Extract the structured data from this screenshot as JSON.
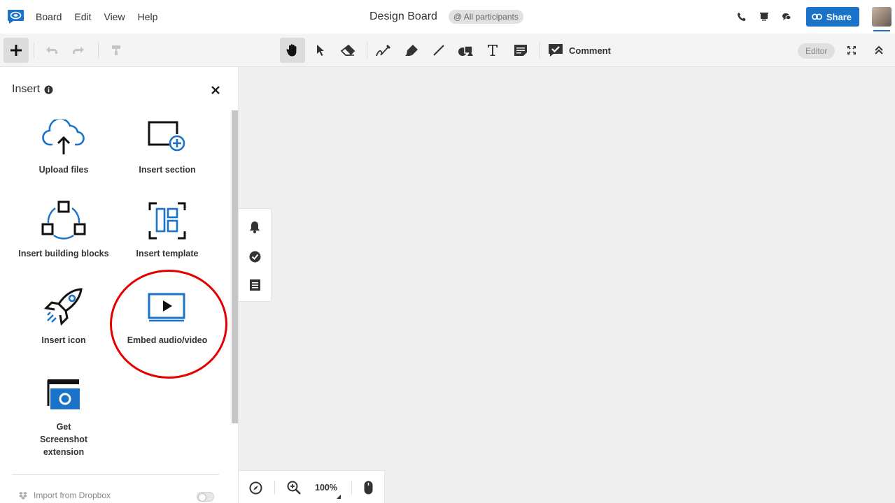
{
  "menu": [
    "Board",
    "Edit",
    "View",
    "Help"
  ],
  "document": {
    "title": "Design Board",
    "participants": "@ All participants"
  },
  "share": {
    "label": "Share"
  },
  "toolbar": {
    "comment_label": "Comment",
    "mode_badge": "Editor"
  },
  "insert_panel": {
    "title": "Insert",
    "items": [
      {
        "label": "Upload files",
        "icon": "cloud-upload-icon"
      },
      {
        "label": "Insert section",
        "icon": "section-add-icon"
      },
      {
        "label": "Insert building blocks",
        "icon": "building-blocks-icon"
      },
      {
        "label": "Insert template",
        "icon": "template-icon"
      },
      {
        "label": "Insert icon",
        "icon": "rocket-icon"
      },
      {
        "label": "Embed audio/video",
        "icon": "video-play-icon"
      },
      {
        "label": "Get Screenshot extension",
        "icon": "screenshot-icon"
      }
    ],
    "dropbox_label": "Import from Dropbox"
  },
  "zoom": {
    "value": "100%"
  },
  "colors": {
    "accent": "#1a73c9",
    "highlight": "#e40000"
  }
}
